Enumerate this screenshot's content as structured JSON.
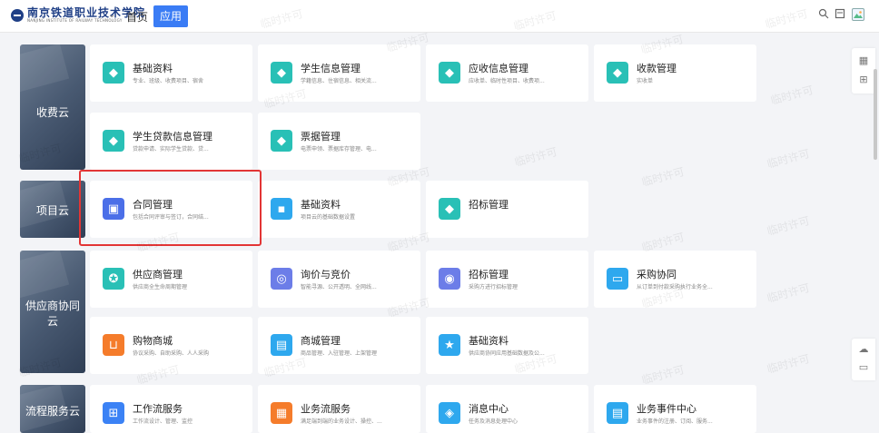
{
  "header": {
    "logo_text": "南京铁道职业技术学院",
    "logo_sub": "NANJING INSTITUTE OF RAILWAY TECHNOLOGY",
    "home_label": "首页",
    "app_label": "应用"
  },
  "watermark": "临时许可",
  "categories": [
    {
      "label": "收费云"
    },
    {
      "label": "项目云"
    },
    {
      "label": "供应商协同云"
    },
    {
      "label": "流程服务云"
    }
  ],
  "cards": {
    "fee": [
      {
        "title": "基础资料",
        "desc": "专业、班级、收费项目、宿舍",
        "icon": "box-icon"
      },
      {
        "title": "学生信息管理",
        "desc": "学籍信息、住宿信息、相关流...",
        "icon": "box-icon"
      },
      {
        "title": "应收信息管理",
        "desc": "应收单、临时性项目、收费项...",
        "icon": "box-icon"
      },
      {
        "title": "收款管理",
        "desc": "实收单",
        "icon": "box-icon"
      },
      {
        "title": "学生贷款信息管理",
        "desc": "贷款申请、实际学生贷款、贷...",
        "icon": "box-icon"
      },
      {
        "title": "票据管理",
        "desc": "电票申领、票据库存管理、电...",
        "icon": "box-icon"
      }
    ],
    "project": [
      {
        "title": "合同管理",
        "desc": "包括合同评审与签订，合同结...",
        "icon": "briefcase-icon"
      },
      {
        "title": "基础资料",
        "desc": "项目云的基础数据设置",
        "icon": "folder-icon"
      },
      {
        "title": "招标管理",
        "desc": "",
        "icon": "box-icon"
      }
    ],
    "supplier": [
      {
        "title": "供应商管理",
        "desc": "供应商全生命周期管理",
        "icon": "badge-icon"
      },
      {
        "title": "询价与竞价",
        "desc": "智能寻源、公开透明、全网线...",
        "icon": "magnifier-icon"
      },
      {
        "title": "招标管理",
        "desc": "采购方进行招标管理",
        "icon": "target-icon"
      },
      {
        "title": "采购协同",
        "desc": "从订单到付款采购执行业务全...",
        "icon": "monitor-icon"
      },
      {
        "title": "购物商城",
        "desc": "协议采购、自助采购、人人采购",
        "icon": "cart-icon"
      },
      {
        "title": "商城管理",
        "desc": "商品管理、入驻管理、上架管理",
        "icon": "store-icon"
      },
      {
        "title": "基础资料",
        "desc": "供应商协同应用基础数据及公...",
        "icon": "star-folder-icon"
      }
    ],
    "workflow": [
      {
        "title": "工作流服务",
        "desc": "工作流设计、管理、监控",
        "icon": "flow-icon"
      },
      {
        "title": "业务流服务",
        "desc": "满足端到端的业务设计、操控、...",
        "icon": "doc-icon"
      },
      {
        "title": "消息中心",
        "desc": "任务及消息处理中心",
        "icon": "diamond-icon"
      },
      {
        "title": "业务事件中心",
        "desc": "业务事件的注册、订阅、服务...",
        "icon": "doc-icon"
      }
    ]
  },
  "colors": {
    "accent": "#3a7cf5",
    "highlight": "#e23535",
    "teal": "#29c0b6",
    "orange": "#f57c2b"
  }
}
